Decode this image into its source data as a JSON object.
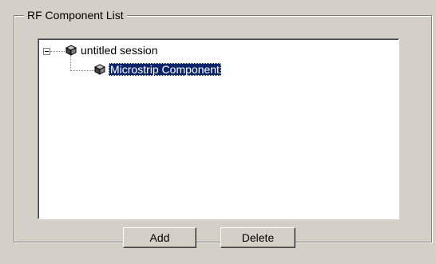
{
  "group": {
    "title": "RF Component List"
  },
  "tree": {
    "root": {
      "label": "untitled session",
      "expanded": true,
      "icon": "cube-icon"
    },
    "children": [
      {
        "label": "Microstrip Component",
        "selected": true,
        "icon": "cube-icon"
      }
    ]
  },
  "buttons": {
    "add_label": "Add",
    "delete_label": "Delete"
  },
  "colors": {
    "window_bg": "#d4d0c8",
    "selection_bg": "#0a246a",
    "selection_fg": "#ffffff"
  }
}
